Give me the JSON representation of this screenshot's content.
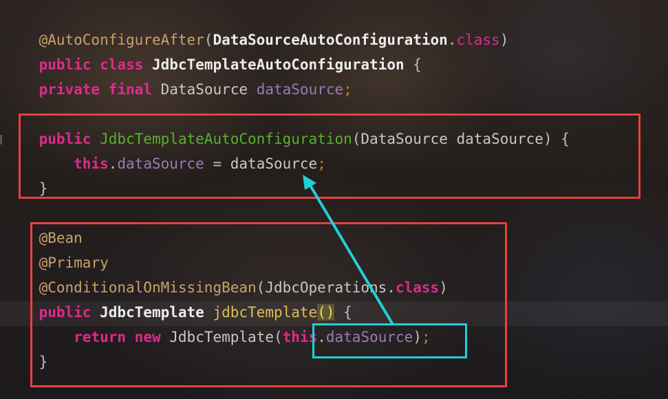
{
  "code": {
    "line1": {
      "annotation": "@AutoConfigureAfter",
      "open": "(",
      "class_name": "DataSourceAutoConfiguration",
      "dot": ".",
      "class_kw": "class",
      "close": ")"
    },
    "line2": {
      "kw_public": "public",
      "kw_class": "class",
      "name": "JdbcTemplateAutoConfiguration",
      "brace": "{"
    },
    "line3": {
      "kw_private": "private",
      "kw_final": "final",
      "type": "DataSource",
      "field": "dataSource",
      "semi": ";"
    },
    "line4": {
      "kw_public": "public",
      "ctor": "JdbcTemplateAutoConfiguration",
      "open": "(",
      "param_type": "DataSource",
      "param_name": "dataSource",
      "close": ")",
      "brace": "{"
    },
    "line5": {
      "kw_this": "this",
      "dot": ".",
      "field": "dataSource",
      "eq": " = ",
      "value": "dataSource",
      "semi": ";"
    },
    "line6": {
      "brace": "}"
    },
    "line7": {
      "annotation": "@Bean"
    },
    "line8": {
      "annotation": "@Primary"
    },
    "line9": {
      "annotation": "@ConditionalOnMissingBean",
      "open": "(",
      "class_name": "JdbcOperations",
      "dot": ".",
      "class_kw": "class",
      "close": ")"
    },
    "line10": {
      "kw_public": "public",
      "type": "JdbcTemplate",
      "method": "jdbcTemplate",
      "parens": "()",
      "brace": "{"
    },
    "line11": {
      "kw_return": "return",
      "kw_new": "new",
      "type": "JdbcTemplate",
      "open": "(",
      "kw_this": "this",
      "dot": ".",
      "field": "dataSource",
      "close": ")",
      "semi": ";"
    },
    "line12": {
      "brace": "}"
    }
  },
  "colors": {
    "highlight_box": "#e8423d",
    "reference_box": "#22cfd6",
    "arrow": "#22cfd6",
    "keyword": "#e02a8c",
    "annotation": "#c9a26d",
    "field": "#9d7ab8",
    "method": "#56b32c"
  }
}
